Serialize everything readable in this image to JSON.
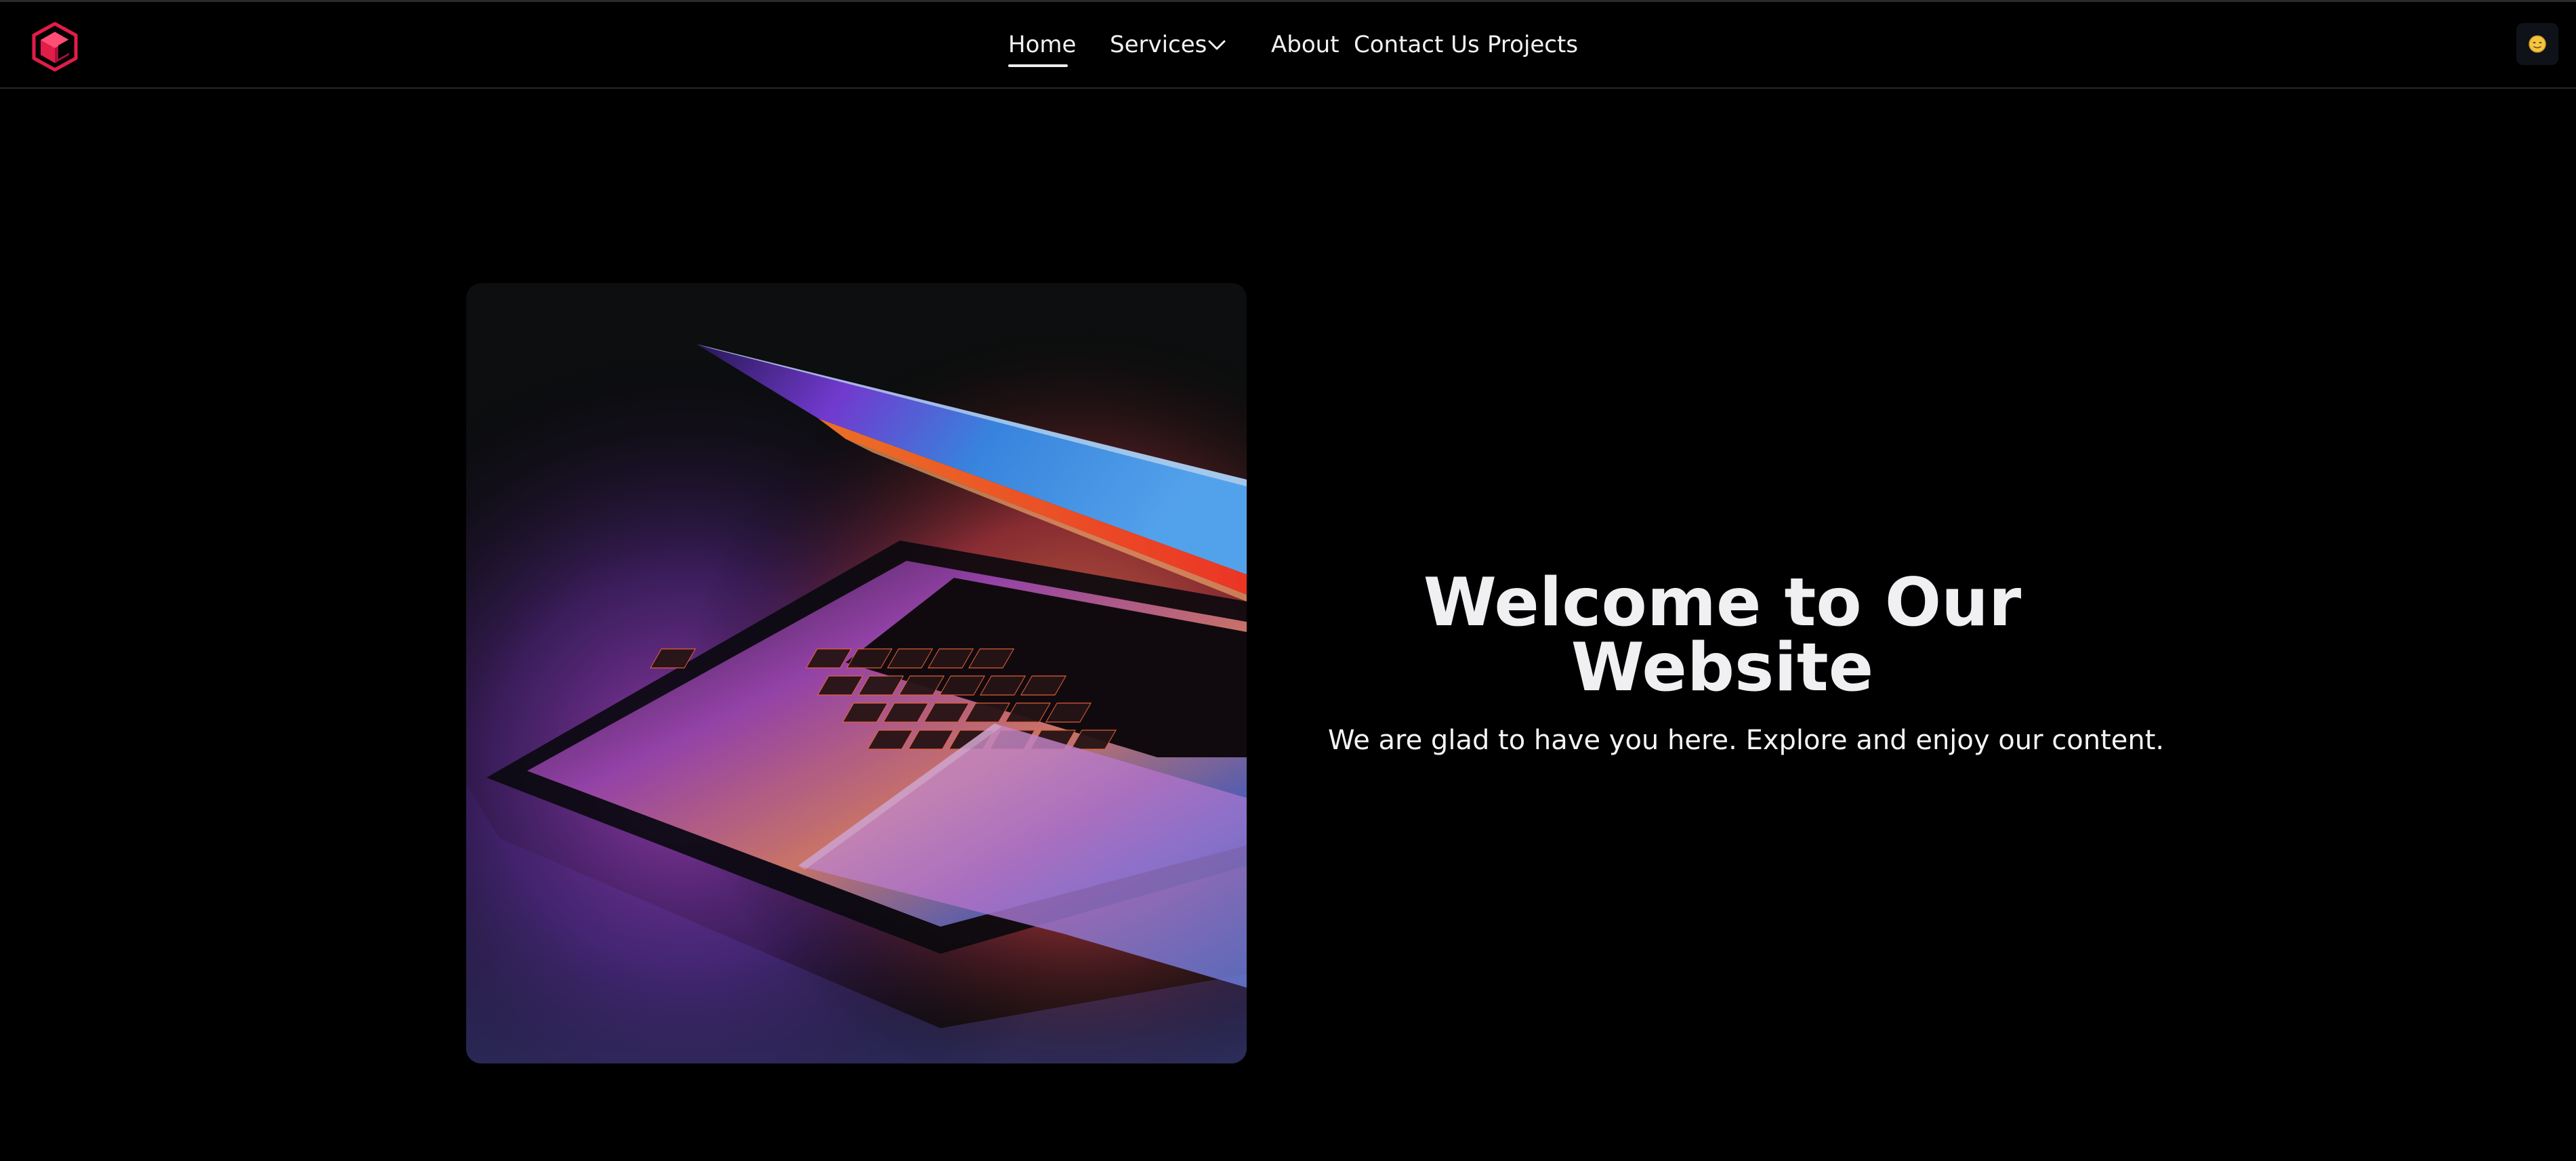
{
  "nav": {
    "logo_icon": "hexagon-cube-logo-icon",
    "brand_color": "#e11d48",
    "items": [
      {
        "label": "Home",
        "active": true
      },
      {
        "label": "Services",
        "has_dropdown": true
      },
      {
        "label": "About"
      },
      {
        "label": "Contact Us"
      },
      {
        "label": "Projects"
      }
    ],
    "theme_toggle_icon": "moon-emoji-icon"
  },
  "hero": {
    "image_subject": "laptop-keyboard-neon-light-image",
    "title": "Welcome to Our Website",
    "subtitle": "We are glad to have you here. Explore and enjoy our content."
  },
  "colors": {
    "background": "#000000",
    "text": "#ededf0",
    "divider": "#27272a"
  }
}
